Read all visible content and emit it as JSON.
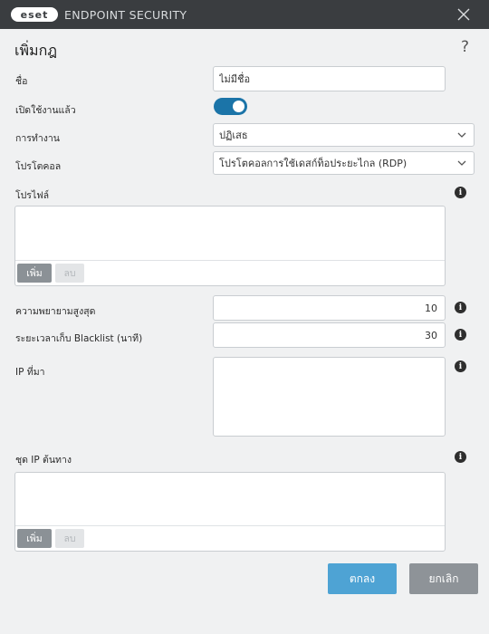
{
  "window": {
    "brand": "eset",
    "title": "ENDPOINT SECURITY"
  },
  "dialog": {
    "heading": "เพิ่มกฎ",
    "help": "?"
  },
  "form": {
    "name_label": "ชื่อ",
    "name_value": "ไม่มีชื่อ",
    "enabled_label": "เปิดใช้งานแล้ว",
    "enabled": true,
    "action_label": "การทำงาน",
    "action_value": "ปฏิเสธ",
    "protocol_label": "โปรโตคอล",
    "protocol_value": "โปรโตคอลการใช้เดสก์ท็อประยะไกล (RDP)",
    "profile_label": "โปรไฟล์",
    "max_attempts_label": "ความพยายามสูงสุด",
    "max_attempts_value": "10",
    "blacklist_label": "ระยะเวลาเก็บ Blacklist (นาที)",
    "blacklist_value": "30",
    "source_ip_label": "IP ที่มา",
    "source_ip_set_label": "ชุด IP ต้นทาง"
  },
  "list_buttons": {
    "add": "เพิ่ม",
    "remove": "ลบ"
  },
  "footer": {
    "ok": "ตกลง",
    "cancel": "ยกเลิก"
  },
  "colors": {
    "titlebar": "#3a3d40",
    "toggle_on": "#1b74a8",
    "primary_button": "#4ea3d4",
    "secondary_button": "#8e9398"
  },
  "icons": {
    "close": "close-icon",
    "info": "info-icon",
    "chevron": "chevron-down-icon"
  }
}
